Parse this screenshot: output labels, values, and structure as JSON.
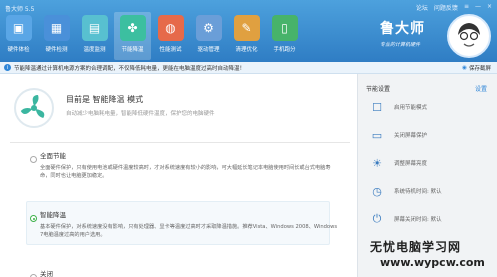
{
  "app": {
    "title": "鲁大师 5.5"
  },
  "window_controls": {
    "forum": "论坛",
    "feedback": "问题反馈",
    "menu": "≡",
    "minimize": "—",
    "close": "×"
  },
  "nav": [
    {
      "label": "硬件体检",
      "icon": "monitor-icon",
      "glyph": "▣"
    },
    {
      "label": "硬件检测",
      "icon": "chip-icon",
      "glyph": "▦"
    },
    {
      "label": "温度监测",
      "icon": "thermometer-icon",
      "glyph": "▤"
    },
    {
      "label": "节能降温",
      "icon": "fan-icon",
      "glyph": "✤"
    },
    {
      "label": "性能测试",
      "icon": "gauge-icon",
      "glyph": "◍"
    },
    {
      "label": "驱动管理",
      "icon": "gear-icon",
      "glyph": "⚙"
    },
    {
      "label": "清理优化",
      "icon": "broom-icon",
      "glyph": "✎"
    },
    {
      "label": "手机跑分",
      "icon": "phone-icon",
      "glyph": "▯"
    }
  ],
  "brand": {
    "name": "鲁大师",
    "slogan": "专业的计算机硬件"
  },
  "infobar": {
    "text": "节能降温通过计算机电源方案的合理调配，不仅降低耗电量，更能在电脑温度过高时自动降温！",
    "snapshot": "保存截屏"
  },
  "current": {
    "title": "目前是 智能降温 模式",
    "subtitle": "自动减少电脑耗电量，智能降低硬件温度，保护您的电脑硬件"
  },
  "modes": [
    {
      "name": "全面节能",
      "desc": "全面硬件保护，只有使用电池或硬件温度较高时，才对系统速度有较小的影响，可大幅延长笔记本电脑使用时间长或台式电脑寿命，同时也让电脑更加稳定。",
      "selected": false
    },
    {
      "name": "智能降温",
      "desc": "基本硬件保护，对系统速度没有影响，只有处理器、显卡等温度过高时才采取降温措施。推荐Vista、Windows 2008、Windows 7电脑温度过高的用户选用。",
      "selected": true
    },
    {
      "name": "关闭",
      "desc": "",
      "selected": false
    }
  ],
  "settings": {
    "header": "节能设置",
    "link": "设置",
    "items": [
      {
        "label": "启用节能模式",
        "icon": "checkbox-icon",
        "glyph": "☐"
      },
      {
        "label": "关闭屏幕保护",
        "icon": "screen-icon",
        "glyph": "▭"
      },
      {
        "label": "调整屏幕亮度",
        "icon": "brightness-icon",
        "glyph": "☀"
      },
      {
        "label": "系统待机时间: 默认",
        "icon": "clock-icon",
        "glyph": "◷"
      },
      {
        "label": "屏幕关闭时间: 默认",
        "icon": "power-icon",
        "glyph": "⏻"
      }
    ]
  },
  "watermark": {
    "line1": "无忧电脑学习网",
    "line2": "www.wypcw.com"
  }
}
